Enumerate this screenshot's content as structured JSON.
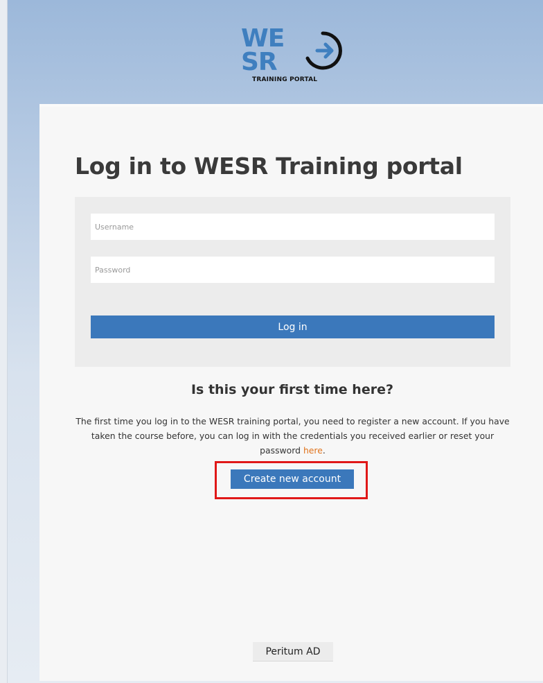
{
  "logo": {
    "line1": "WE",
    "line2": "SR",
    "subtitle": "TRAINING PORTAL",
    "icon": "arrow-circle-icon"
  },
  "login": {
    "title": "Log in to WESR Training portal",
    "username_placeholder": "Username",
    "password_placeholder": "Password",
    "login_label": "Log in"
  },
  "first_time": {
    "heading": "Is this your first time here?",
    "text": "The first time you log in to the WESR training portal, you need to register a new account. If you have taken the course before, you can log in with the credentials you received earlier or reset your password ",
    "link_text": "here",
    "text_end": ".",
    "create_label": "Create new account"
  },
  "footer": {
    "label": "Peritum AD"
  },
  "colors": {
    "accent": "#3b78bb",
    "link": "#e0731c",
    "highlight": "#e01818"
  }
}
